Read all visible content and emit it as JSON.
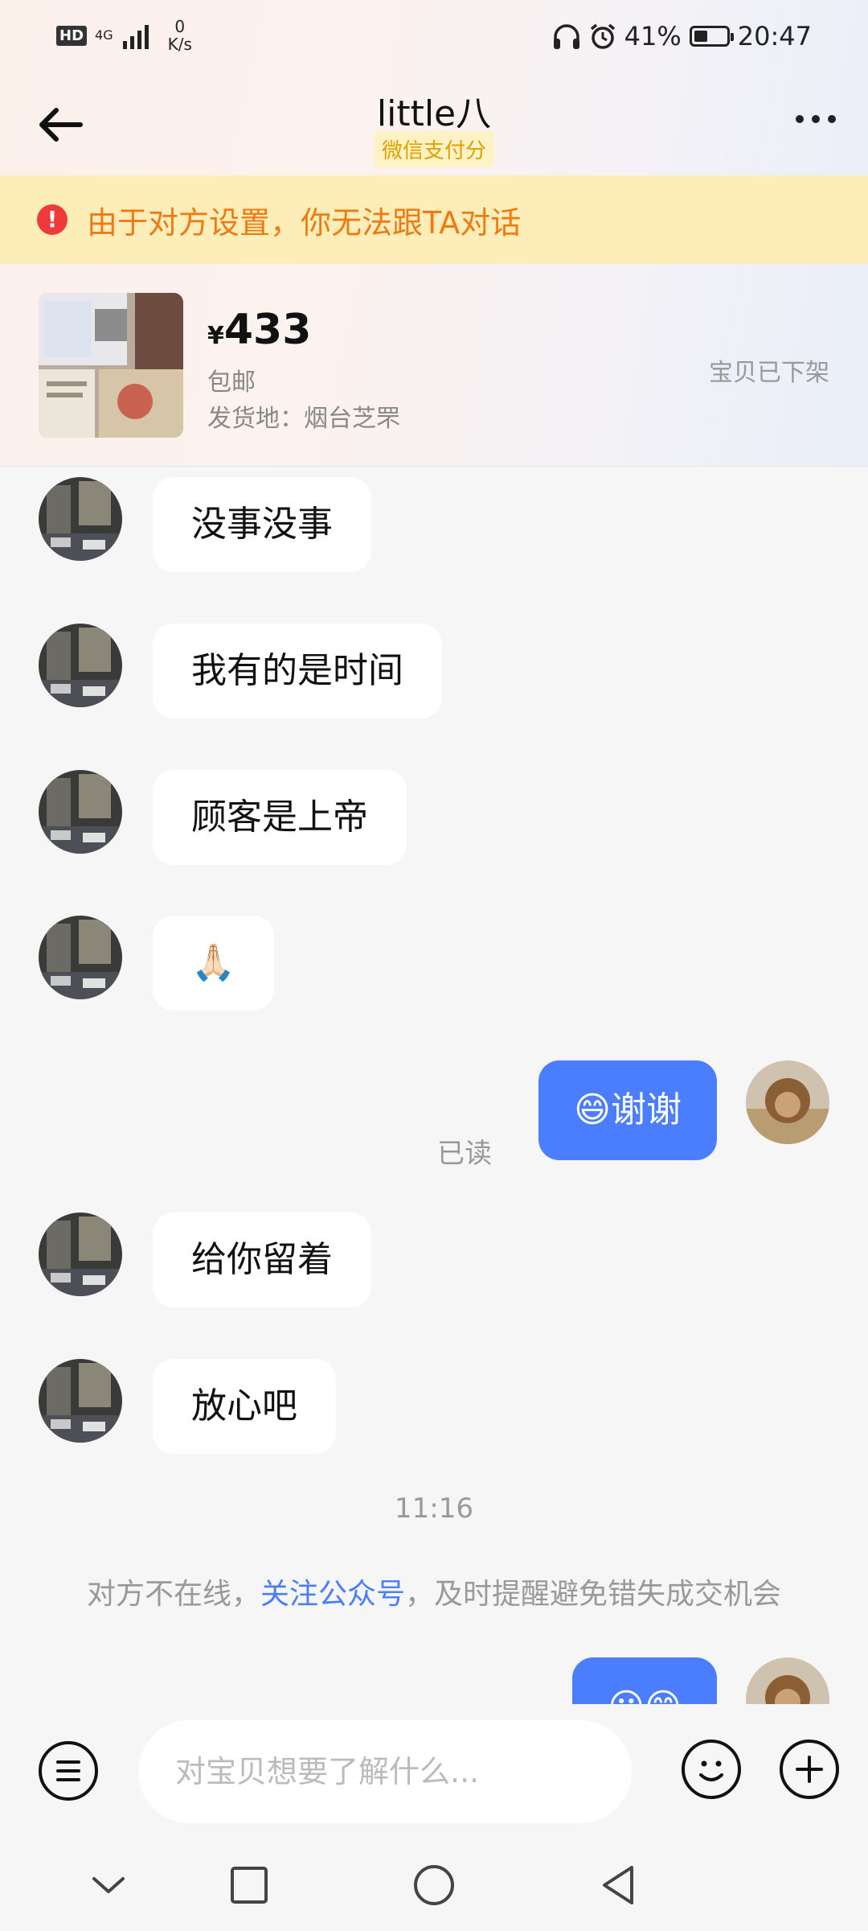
{
  "status_bar": {
    "hd": "HD",
    "network": "4G",
    "speed_value": "0",
    "speed_unit": "K/s",
    "battery": "41%",
    "battery_level": 0.41,
    "time": "20:47"
  },
  "header": {
    "title": "little八",
    "subtitle": "微信支付分"
  },
  "warning": {
    "text": "由于对方设置，你无法跟TA对话"
  },
  "product": {
    "currency": "¥",
    "price": "433",
    "shipping": "包邮",
    "origin": "发货地：烟台芝罘",
    "status": "宝贝已下架"
  },
  "messages": [
    {
      "side": "left",
      "text": "没事没事"
    },
    {
      "side": "left",
      "text": "我有的是时间"
    },
    {
      "side": "left",
      "text": "顾客是上帝"
    },
    {
      "side": "left",
      "text": "🙏🏻"
    },
    {
      "side": "right",
      "text": "😄谢谢",
      "status": "已读"
    },
    {
      "side": "left",
      "text": "给你留着"
    },
    {
      "side": "left",
      "text": "放心吧"
    }
  ],
  "time_divider": "11:16",
  "notice": {
    "before": "对方不在线，",
    "link": "关注公众号",
    "after": "，及时提醒避免错失成交机会"
  },
  "last_message": {
    "side": "right",
    "text": "😶😊"
  },
  "input": {
    "placeholder": "对宝贝想要了解什么..."
  },
  "colors": {
    "accent": "#4a7dff",
    "warning_bg": "#fdedb8",
    "warning_text": "#f07a12",
    "subtitle_text": "#e0a000"
  }
}
